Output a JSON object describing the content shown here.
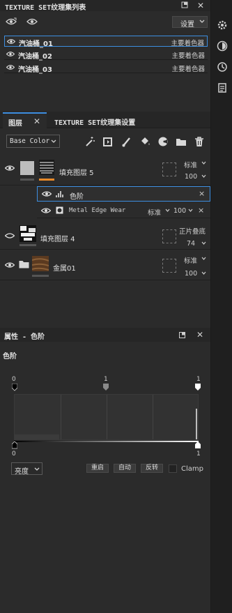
{
  "texture_sets": {
    "title": "TEXTURE SET纹理集列表",
    "settings_label": "设置",
    "items": [
      {
        "name": "汽油桶_01",
        "shader": "主要着色器",
        "selected": true
      },
      {
        "name": "汽油桶_02",
        "shader": "主要着色器",
        "selected": false
      },
      {
        "name": "汽油桶_03",
        "shader": "主要着色器",
        "selected": false
      }
    ]
  },
  "layers_panel": {
    "tabs": [
      {
        "label": "图层",
        "active": true
      },
      {
        "label": "TEXTURE SET纹理集设置",
        "active": false
      }
    ],
    "channel_dropdown": "Base Color",
    "layers": [
      {
        "name": "填充图层 5",
        "blend": "标准",
        "opacity": "100"
      },
      {
        "name": "填充图层 4",
        "blend": "正片叠底",
        "opacity": "74"
      },
      {
        "name": "金属01",
        "blend": "标准",
        "opacity": "100"
      }
    ],
    "effects": [
      {
        "name": "色阶",
        "close": "×"
      },
      {
        "name": "Metal Edge Wear",
        "blend": "标准",
        "opacity": "100",
        "close": "×"
      }
    ]
  },
  "properties": {
    "title": "属性 - 色阶",
    "section_label": "色阶",
    "input_low": "0",
    "input_mid": "1",
    "input_high": "1",
    "output_low": "0",
    "output_high": "1",
    "channel": "亮度",
    "reset_label": "重启",
    "auto_label": "自动",
    "invert_label": "反转",
    "clamp_label": "Clamp"
  },
  "colors": {
    "accent": "#3d8ee0",
    "mask_orange": "#e88a2a"
  }
}
